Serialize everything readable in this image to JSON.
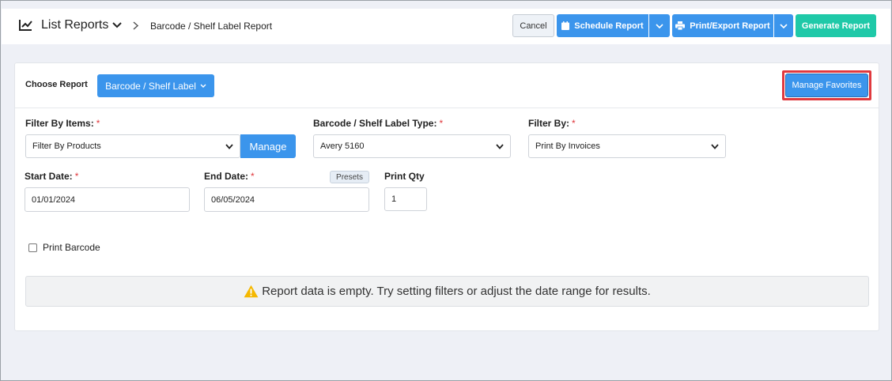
{
  "header": {
    "title": "List Reports",
    "breadcrumb": "Barcode / Shelf Label Report",
    "icon": "line-chart-icon"
  },
  "toolbar": {
    "cancel_label": "Cancel",
    "schedule_label": "Schedule Report",
    "print_label": "Print/Export Report",
    "generate_label": "Generate Report",
    "colors": {
      "primary": "#3b95ec",
      "success": "#1fc9a8"
    }
  },
  "choose": {
    "label": "Choose Report",
    "selected": "Barcode / Shelf Label",
    "manage_favorites": "Manage Favorites"
  },
  "filters": {
    "filter_items_label": "Filter By Items:",
    "filter_items_value": "Filter By Products",
    "manage_label": "Manage",
    "label_type_label": "Barcode / Shelf Label Type:",
    "label_type_value": "Avery 5160",
    "filter_by_label": "Filter By:",
    "filter_by_value": "Print By Invoices",
    "required_mark": "*"
  },
  "dates": {
    "start_label": "Start Date:",
    "start_value": "01/01/2024",
    "end_label": "End Date:",
    "end_value": "06/05/2024",
    "presets_label": "Presets",
    "qty_label": "Print Qty",
    "qty_value": "1"
  },
  "options": {
    "print_barcode_label": "Print Barcode",
    "print_barcode_checked": false
  },
  "alert": {
    "message": "Report data is empty. Try setting filters or adjust the date range for results.",
    "icon": "warning-icon",
    "color": "#f5b800"
  }
}
